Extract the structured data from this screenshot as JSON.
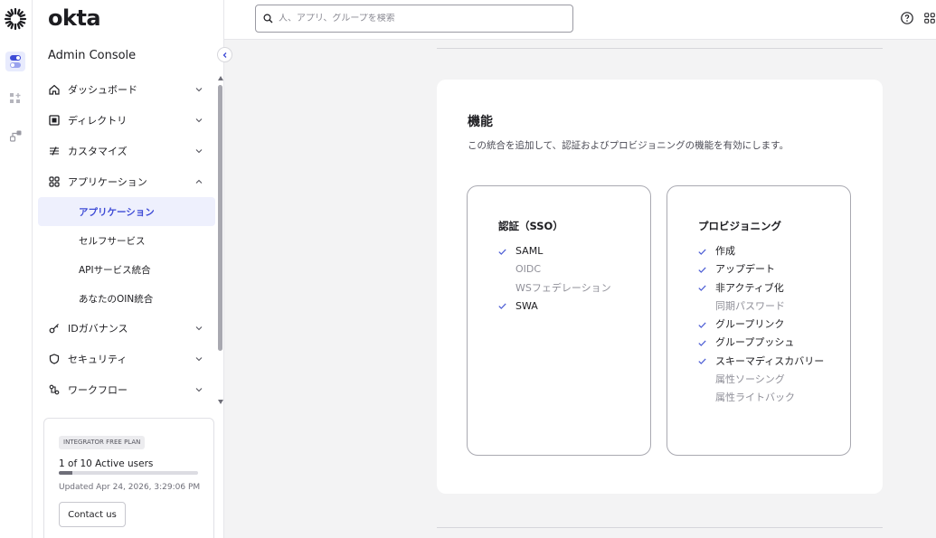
{
  "brand": "okta",
  "sidebar": {
    "console_title": "Admin Console",
    "nav": [
      {
        "label": "ダッシュボード",
        "icon": "home-icon"
      },
      {
        "label": "ディレクトリ",
        "icon": "directory-icon"
      },
      {
        "label": "カスタマイズ",
        "icon": "customize-icon"
      },
      {
        "label": "アプリケーション",
        "icon": "apps-grid-icon",
        "expanded": true
      }
    ],
    "sub_items": [
      "アプリケーション",
      "セルフサービス",
      "APIサービス統合",
      "あなたのOIN統合"
    ],
    "nav_after": [
      {
        "label": "IDガバナンス",
        "icon": "key-icon"
      },
      {
        "label": "セキュリティ",
        "icon": "shield-icon"
      },
      {
        "label": "ワークフロー",
        "icon": "workflow-icon"
      }
    ]
  },
  "plan": {
    "badge": "INTEGRATOR FREE PLAN",
    "users": "1 of 10 Active users",
    "usage_fraction": 0.1,
    "updated": "Updated Apr 24, 2026, 3:29:06 PM",
    "contact": "Contact us"
  },
  "search": {
    "placeholder": "人、アプリ、グループを検索"
  },
  "card": {
    "title": "機能",
    "description": "この統合を追加して、認証およびプロビジョニングの機能を有効にします。",
    "sso": {
      "title": "認証（SSO）",
      "items": [
        {
          "label": "SAML",
          "enabled": true
        },
        {
          "label": "OIDC",
          "enabled": false
        },
        {
          "label": "WSフェデレーション",
          "enabled": false
        },
        {
          "label": "SWA",
          "enabled": true
        }
      ]
    },
    "provisioning": {
      "title": "プロビジョニング",
      "items": [
        {
          "label": "作成",
          "enabled": true
        },
        {
          "label": "アップデート",
          "enabled": true
        },
        {
          "label": "非アクティブ化",
          "enabled": true
        },
        {
          "label": "同期パスワード",
          "enabled": false
        },
        {
          "label": "グループリンク",
          "enabled": true
        },
        {
          "label": "グループプッシュ",
          "enabled": true
        },
        {
          "label": "スキーマディスカバリー",
          "enabled": true
        },
        {
          "label": "属性ソーシング",
          "enabled": false
        },
        {
          "label": "属性ライトバック",
          "enabled": false
        }
      ]
    }
  },
  "colors": {
    "accent": "#3e4bd6",
    "check": "#4a5bd4",
    "disabled_text": "#8f8f98"
  }
}
